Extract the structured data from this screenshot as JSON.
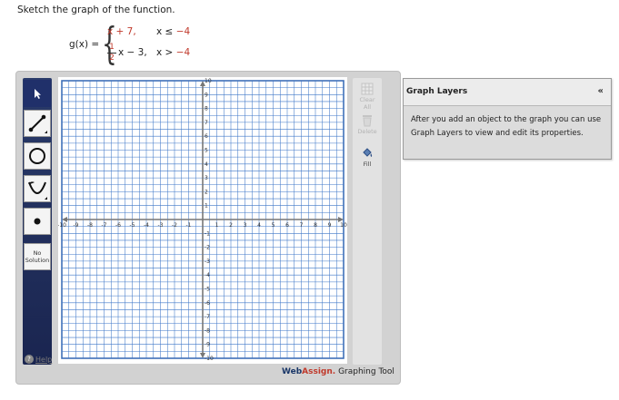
{
  "prompt": "Sketch the graph of the function.",
  "function": {
    "lhs": "g(x) =",
    "piece1": {
      "expr": "x + 7,",
      "cond": "x ≤ −4",
      "cond_prefix": "x ≤ ",
      "cond_num": "−4"
    },
    "piece2": {
      "frac_num": "1",
      "frac_den": "2",
      "expr_rest": "x − 3,",
      "cond_prefix": "x > ",
      "cond_num": "−4"
    }
  },
  "toolbar": {
    "no_solution_line1": "No",
    "no_solution_line2": "Solution",
    "tools": [
      "pointer-tool",
      "line-tool",
      "circle-tool",
      "parabola-tool",
      "point-tool"
    ]
  },
  "side_tools": {
    "clear_label": "Clear All",
    "delete_label": "Delete",
    "fill_label": "Fill"
  },
  "help_label": "Help",
  "graph": {
    "x_min": -10,
    "x_max": 10,
    "y_min": -10,
    "y_max": 10,
    "x_ticks": [
      "-10",
      "-9",
      "-8",
      "-7",
      "-6",
      "-5",
      "-4",
      "-3",
      "-2",
      "-1",
      "1",
      "2",
      "3",
      "4",
      "5",
      "6",
      "7",
      "8",
      "9",
      "10"
    ],
    "y_ticks": [
      "10",
      "9",
      "8",
      "7",
      "6",
      "5",
      "4",
      "3",
      "2",
      "1",
      "-1",
      "-2",
      "-3",
      "-4",
      "-5",
      "-6",
      "-7",
      "-8",
      "-9",
      "-10"
    ]
  },
  "brand": {
    "web": "Web",
    "assign": "Assign.",
    "rest": " Graphing Tool"
  },
  "layers": {
    "title": "Graph Layers",
    "collapse": "«",
    "body": "After you add an object to the graph you can use Graph Layers to view and edit its properties."
  }
}
